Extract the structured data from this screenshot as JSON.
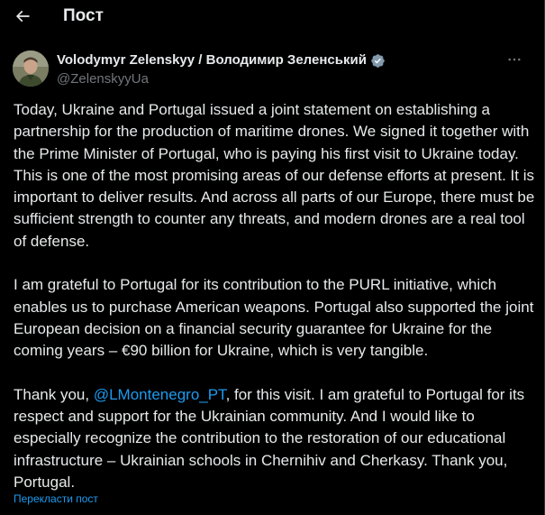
{
  "header": {
    "title": "Пост"
  },
  "author": {
    "name": "Volodymyr Zelenskyy / Володимир Зеленський",
    "handle": "@ZelenskyyUa",
    "verified_color": "#829aab"
  },
  "tweet": {
    "paragraph1": "Today, Ukraine and Portugal issued a joint statement on establishing a partnership for the production of maritime drones. We signed it together with the Prime Minister of Portugal, who is paying his first visit to Ukraine today. This is one of the most promising areas of our defense efforts at present. It is important to deliver results. And across all parts of our Europe, there must be sufficient strength to counter any threats, and modern drones are a real tool of defense.",
    "paragraph2": "I am grateful to Portugal for its contribution to the PURL initiative, which enables us to purchase American weapons. Portugal also supported the joint European decision on a financial security guarantee for Ukraine for the coming years – €90 billion for Ukraine, which is very tangible.",
    "paragraph3_before": "Thank you, ",
    "mention": "@LMontenegro_PT",
    "paragraph3_after": ", for this visit. I am grateful to Portugal for its respect and support for the Ukrainian community. And I would like to especially recognize the contribution to the restoration of our educational infrastructure – Ukrainian schools in Chernihiv and Cherkasy. Thank you, Portugal."
  },
  "translate_label": "Перекласти пост",
  "icons": {
    "back": "arrow-left-icon",
    "verified": "verified-badge-icon",
    "more": "more-horizontal-icon"
  },
  "colors": {
    "background": "#000000",
    "text": "#e7e9ea",
    "secondary": "#71767b",
    "accent": "#1d9bf0"
  }
}
